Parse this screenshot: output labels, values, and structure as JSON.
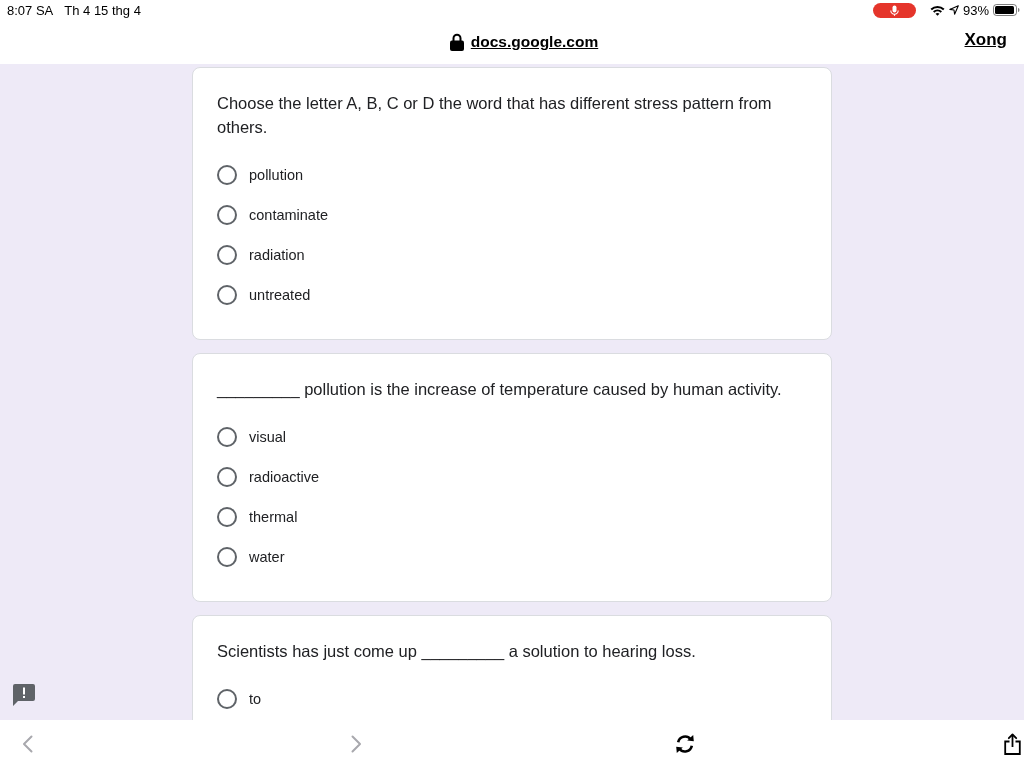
{
  "status_bar": {
    "time": "8:07 SA",
    "date": "Th 4 15 thg 4",
    "battery": "93%"
  },
  "address_bar": {
    "url": "docs.google.com",
    "done": "Xong"
  },
  "questions": [
    {
      "text": "Choose the letter A, B, C or D the word that has different stress pattern from others.",
      "options": [
        {
          "label": "pollution",
          "selected": false
        },
        {
          "label": "contaminate",
          "selected": false
        },
        {
          "label": "radiation",
          "selected": false
        },
        {
          "label": "untreated",
          "selected": false
        }
      ]
    },
    {
      "text": "_________ pollution is the increase of temperature caused by human activity.",
      "options": [
        {
          "label": "visual",
          "selected": false
        },
        {
          "label": "radioactive",
          "selected": false
        },
        {
          "label": "thermal",
          "selected": false
        },
        {
          "label": "water",
          "selected": false
        }
      ]
    },
    {
      "text": "Scientists has just come up _________ a solution to hearing loss.",
      "options": [
        {
          "label": "to",
          "selected": false
        }
      ]
    }
  ],
  "toolbar": [
    {
      "kind": "back",
      "disabled": true
    },
    {
      "kind": "forward",
      "disabled": true
    },
    {
      "kind": "reload",
      "disabled": false
    },
    {
      "kind": "share",
      "disabled": false
    }
  ]
}
